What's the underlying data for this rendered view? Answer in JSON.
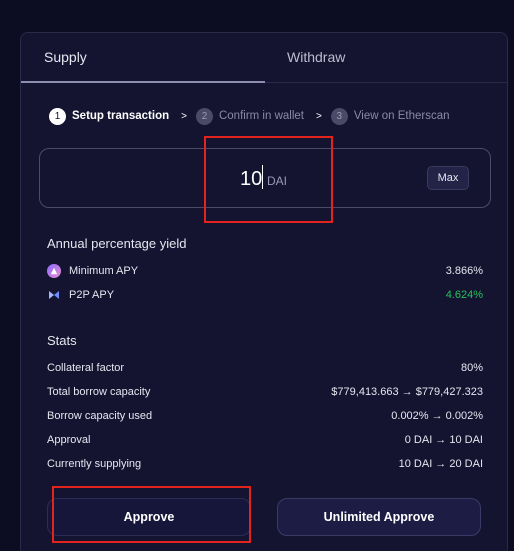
{
  "tabs": {
    "supply": "Supply",
    "withdraw": "Withdraw"
  },
  "steps": [
    {
      "num": "1",
      "label": "Setup transaction"
    },
    {
      "num": "2",
      "label": "Confirm in wallet"
    },
    {
      "num": "3",
      "label": "View on Etherscan"
    }
  ],
  "step_separator": ">",
  "amount": {
    "value": "10",
    "unit": "DAI",
    "max_label": "Max"
  },
  "apy": {
    "title": "Annual percentage yield",
    "rows": [
      {
        "label": "Minimum APY",
        "value": "3.866%",
        "icon": "morpho-icon"
      },
      {
        "label": "P2P APY",
        "value": "4.624%",
        "icon": "p2p-icon",
        "value_color": "#21c35a"
      }
    ]
  },
  "stats": {
    "title": "Stats",
    "rows": [
      {
        "label": "Collateral factor",
        "value": "80%"
      },
      {
        "label": "Total borrow capacity",
        "value": "$779,413.663 → $779,427.323"
      },
      {
        "label": "Borrow capacity used",
        "value": "0.002% → 0.002%"
      },
      {
        "label": "Approval",
        "value": "0 DAI → 10 DAI"
      },
      {
        "label": "Currently supplying",
        "value": "10 DAI → 20 DAI"
      }
    ]
  },
  "buttons": {
    "approve": "Approve",
    "unlimited": "Unlimited Approve"
  },
  "colors": {
    "background": "#0c0c22",
    "panel": "#141430",
    "positive": "#21c35a",
    "highlight": "#e4231c"
  }
}
